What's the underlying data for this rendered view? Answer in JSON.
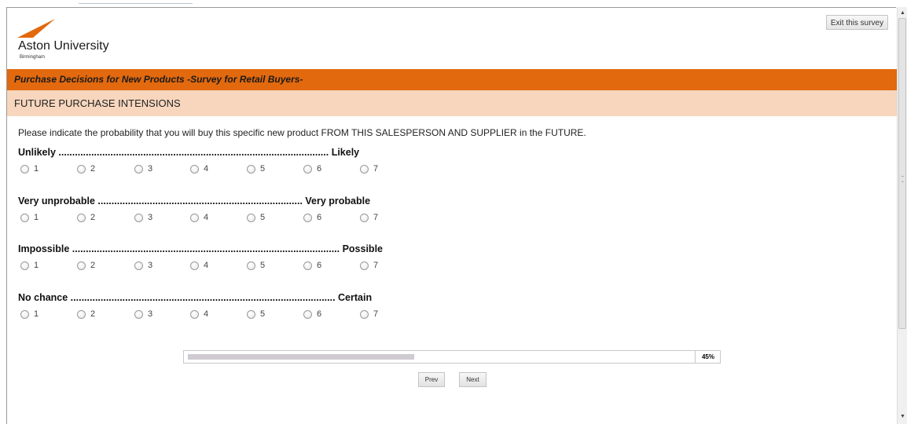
{
  "header": {
    "logo_name": "Aston University",
    "logo_city": "Birmingham",
    "exit_label": "Exit this survey",
    "brand_color": "#e2690e"
  },
  "survey": {
    "title": "Purchase Decisions for New Products -Survey for Retail Buyers-",
    "section": "FUTURE PURCHASE INTENSIONS",
    "question": "Please indicate the probability that you will buy this specific new product FROM THIS SALESPERSON AND SUPPLIER in the FUTURE."
  },
  "scales": [
    {
      "label": "Unlikely ................................................................................................... Likely",
      "options": [
        "1",
        "2",
        "3",
        "4",
        "5",
        "6",
        "7"
      ]
    },
    {
      "label": "Very unprobable ........................................................................... Very probable",
      "options": [
        "1",
        "2",
        "3",
        "4",
        "5",
        "6",
        "7"
      ]
    },
    {
      "label": "Impossible .................................................................................................. Possible",
      "options": [
        "1",
        "2",
        "3",
        "4",
        "5",
        "6",
        "7"
      ]
    },
    {
      "label": "No chance ................................................................................................. Certain",
      "options": [
        "1",
        "2",
        "3",
        "4",
        "5",
        "6",
        "7"
      ]
    }
  ],
  "progress": {
    "percent": 45,
    "label": "45%"
  },
  "nav": {
    "prev_label": "Prev",
    "next_label": "Next"
  },
  "icons": {
    "scroll_up": "chevron-up-icon",
    "scroll_down": "chevron-down-icon"
  }
}
